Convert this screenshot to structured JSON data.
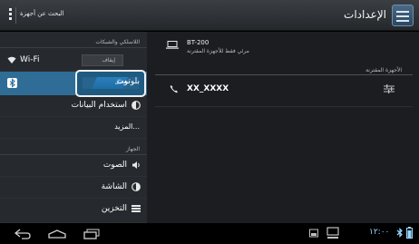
{
  "app": {
    "title": "الإعدادات"
  },
  "action_bar": {
    "search_label": "البحث عن أجهزة"
  },
  "sidebar": {
    "section_wireless": "اللاسلكي والشبكات",
    "wifi": {
      "label": "Wi-Fi",
      "switch_state": "إيقاف"
    },
    "bluetooth": {
      "label": "بلوتوث",
      "switch_state": "تشغيل"
    },
    "data_usage": {
      "label": "استخدام البيانات"
    },
    "more": {
      "label": "المزيد..."
    },
    "section_device": "الجهاز",
    "sound": {
      "label": "الصوت"
    },
    "display": {
      "label": "الشاشة"
    },
    "storage": {
      "label": "التخزين"
    }
  },
  "content": {
    "device": {
      "name": "BT-200",
      "subtitle": "مرئي فقط للأجهزة المقترنة"
    },
    "paired_header": "الأجهزة المقترنة",
    "paired": [
      {
        "name": "XX_XXXX"
      }
    ]
  },
  "system_bar": {
    "time": "١٢:٠٠"
  },
  "colors": {
    "selected": "#2f6d97",
    "accent": "#33b5e5"
  },
  "icons": {
    "wifi": "wifi-icon",
    "bluetooth": "bluetooth-icon",
    "data": "data-usage-icon",
    "sound": "sound-icon",
    "display": "display-icon",
    "storage": "storage-icon",
    "laptop": "laptop-icon",
    "phone": "phone-icon",
    "tune": "tune-icon",
    "back": "back-icon",
    "home": "home-icon",
    "recents": "recents-icon"
  }
}
